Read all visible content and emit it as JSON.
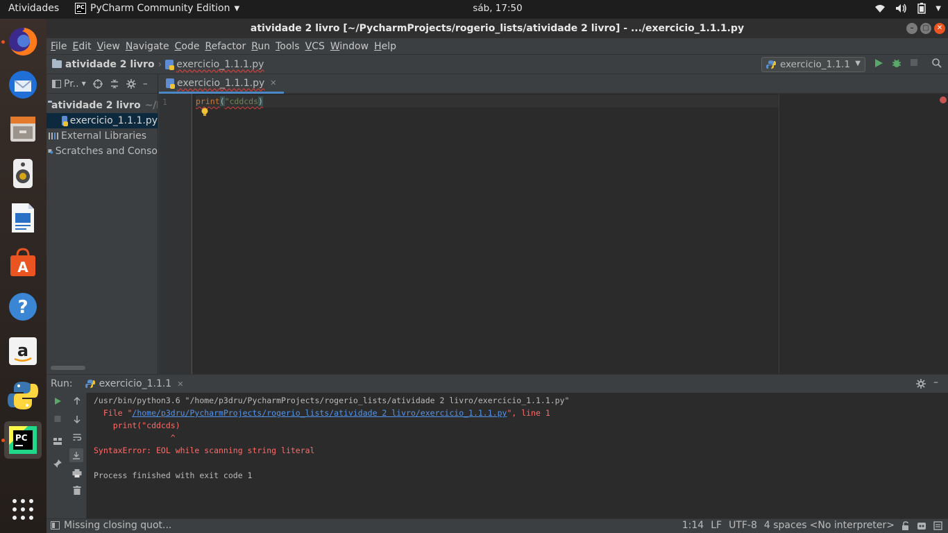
{
  "topbar": {
    "activities": "Atividades",
    "app_name": "PyCharm Community Edition",
    "clock": "sáb, 17:50"
  },
  "window": {
    "title": "atividade 2 livro [~/PycharmProjects/rogerio_lists/atividade 2 livro] - .../exercicio_1.1.1.py"
  },
  "menu": [
    "File",
    "Edit",
    "View",
    "Navigate",
    "Code",
    "Refactor",
    "Run",
    "Tools",
    "VCS",
    "Window",
    "Help"
  ],
  "breadcrumb": {
    "project": "atividade 2 livro",
    "file": "exercicio_1.1.1.py"
  },
  "run_config": "exercicio_1.1.1",
  "project_panel": {
    "title": "Pr..",
    "root": "atividade 2 livro",
    "root_path": "~/P",
    "file": "exercicio_1.1.1.py",
    "external": "External Libraries",
    "scratches": "Scratches and Conso"
  },
  "editor": {
    "tab": "exercicio_1.1.1.py",
    "line_number": "1",
    "code_fn": "print",
    "code_open": "(",
    "code_str": "\"cddcds",
    "code_close": ")"
  },
  "run": {
    "label": "Run:",
    "tab": "exercicio_1.1.1",
    "lines": {
      "cmd": "/usr/bin/python3.6 \"/home/p3dru/PycharmProjects/rogerio_lists/atividade 2 livro/exercicio_1.1.1.py\"",
      "file_prefix": "  File \"",
      "file_link": "/home/p3dru/PycharmProjects/rogerio_lists/atividade 2 livro/exercicio_1.1.1.py",
      "file_suffix": "\", line 1",
      "code": "    print(\"cddcds)",
      "caret": "                ^",
      "error": "SyntaxError: EOL while scanning string literal",
      "exit": "Process finished with exit code 1"
    }
  },
  "status": {
    "message": "Missing closing quot...",
    "position": "1:14",
    "line_sep": "LF",
    "encoding": "UTF-8",
    "indent": "4 spaces",
    "interpreter": "<No interpreter>"
  },
  "colors": {
    "accent": "#4a88c7",
    "error": "#ff6b68",
    "ubuntu_orange": "#e95420"
  }
}
